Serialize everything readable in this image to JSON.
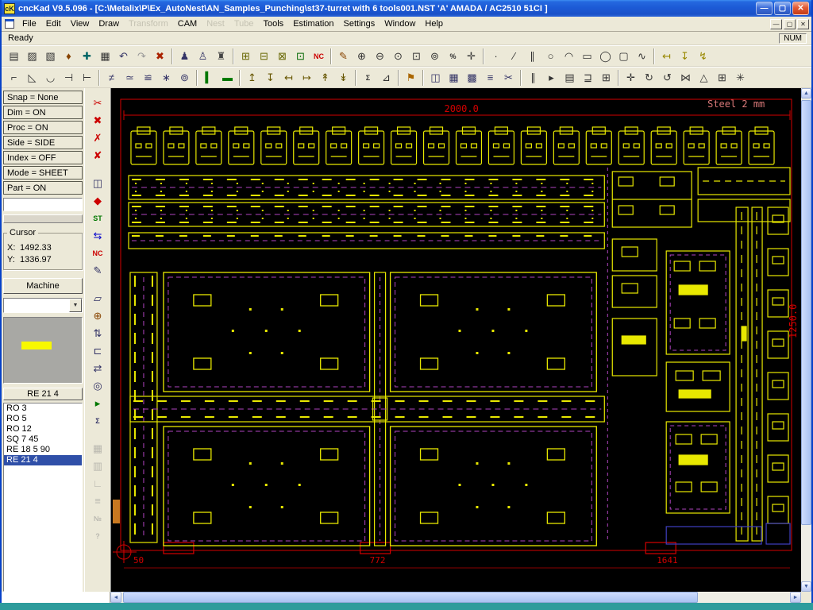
{
  "window": {
    "title": "cncKad V9.5.096 - [C:\\Metalix\\P\\Ex_AutoNest\\AN_Samples_Punching\\st37-turret with 6 tools001.NST  'A'  AMADA / AC2510   51CI ]",
    "app_icon_text": "cK",
    "controls": {
      "minimize": "—",
      "maximize": "▢",
      "close": "✕"
    },
    "mdi": {
      "minimize": "—",
      "restore": "▢",
      "close": "✕"
    }
  },
  "menu": {
    "items": [
      {
        "label": "File"
      },
      {
        "label": "Edit"
      },
      {
        "label": "View"
      },
      {
        "label": "Draw"
      },
      {
        "label": "Transform",
        "d": 1
      },
      {
        "label": "CAM"
      },
      {
        "label": "Nest",
        "d": 1
      },
      {
        "label": "Tube",
        "d": 1
      },
      {
        "label": "Tools"
      },
      {
        "label": "Estimation"
      },
      {
        "label": "Settings"
      },
      {
        "label": "Window"
      },
      {
        "label": "Help"
      }
    ]
  },
  "statusbar": {
    "ready": "Ready",
    "num": "NUM"
  },
  "toolbar1": {
    "items": [
      {
        "n": "print-icon",
        "g": "▤"
      },
      {
        "n": "open-file-icon",
        "g": "▨"
      },
      {
        "n": "new-part-icon",
        "g": "▧"
      },
      {
        "n": "stamp-icon",
        "g": "♦",
        "c": "#884400"
      },
      {
        "n": "tag-icon",
        "g": "✚",
        "c": "#006666"
      },
      {
        "n": "save-icon",
        "g": "▦"
      },
      {
        "n": "undo-icon",
        "g": "↶",
        "c": "#333366"
      },
      {
        "n": "redo-icon",
        "g": "↷",
        "c": "#999999"
      },
      {
        "n": "delete-icon",
        "g": "✖",
        "c": "#aa2200"
      },
      {
        "sep": true
      },
      {
        "n": "punch-tool-icon",
        "g": "♟",
        "c": "#333366"
      },
      {
        "n": "sequence-icon",
        "g": "♙",
        "c": "#333366"
      },
      {
        "n": "turret-setup-icon",
        "g": "♜",
        "c": "#444444"
      },
      {
        "sep": true
      },
      {
        "n": "auto-punch-icon",
        "g": "⊞",
        "c": "#666600"
      },
      {
        "n": "common-punch-icon",
        "g": "⊟",
        "c": "#666600"
      },
      {
        "n": "micro-joint-icon",
        "g": "⊠",
        "c": "#666600"
      },
      {
        "n": "sheet-icon",
        "g": "⊡",
        "c": "#006600"
      },
      {
        "n": "nc-generate-icon",
        "g": "NC",
        "c": "#cc0000",
        "t": 1
      },
      {
        "sep": true
      },
      {
        "n": "draw-pencil-icon",
        "g": "✎",
        "c": "#884400"
      },
      {
        "n": "zoom-in-icon",
        "g": "⊕"
      },
      {
        "n": "zoom-out-icon",
        "g": "⊖"
      },
      {
        "n": "zoom-all-icon",
        "g": "⊙"
      },
      {
        "n": "zoom-window-icon",
        "g": "⊡"
      },
      {
        "n": "zoom-part-icon",
        "g": "⊚"
      },
      {
        "n": "zoom-scale-icon",
        "g": "%",
        "t": 1
      },
      {
        "n": "pan-icon",
        "g": "✛"
      },
      {
        "sep": true
      },
      {
        "n": "draw-point-icon",
        "g": "∙"
      },
      {
        "n": "draw-line-icon",
        "g": "∕"
      },
      {
        "n": "draw-parallel-icon",
        "g": "∥"
      },
      {
        "n": "draw-circle-icon",
        "g": "○"
      },
      {
        "n": "draw-arc-icon",
        "g": "◠"
      },
      {
        "n": "draw-rect-icon",
        "g": "▭"
      },
      {
        "n": "draw-ellipse-icon",
        "g": "◯"
      },
      {
        "n": "draw-rounded-rect-icon",
        "g": "▢"
      },
      {
        "n": "draw-polyline-icon",
        "g": "∿"
      },
      {
        "sep": true
      },
      {
        "n": "dim-horizontal-icon",
        "g": "↤",
        "c": "#998800"
      },
      {
        "n": "dim-vertical-icon",
        "g": "↧",
        "c": "#998800"
      },
      {
        "n": "dim-diagonal-icon",
        "g": "↯",
        "c": "#998800"
      }
    ]
  },
  "toolbar2": {
    "items": [
      {
        "n": "corner-icon",
        "g": "⌐"
      },
      {
        "n": "chamfer-icon",
        "g": "◺"
      },
      {
        "n": "fillet-icon",
        "g": "◡"
      },
      {
        "n": "trim-icon",
        "g": "⊣"
      },
      {
        "n": "extend-icon",
        "g": "⊢"
      },
      {
        "sep": true
      },
      {
        "n": "punch-line-icon",
        "g": "≠",
        "c": "#333366"
      },
      {
        "n": "punch-arc-icon",
        "g": "≃",
        "c": "#333366"
      },
      {
        "n": "punch-area-icon",
        "g": "≌",
        "c": "#333366"
      },
      {
        "n": "destruct-icon",
        "g": "∗",
        "c": "#333366"
      },
      {
        "n": "wheel-tool-icon",
        "g": "⊚",
        "c": "#333366"
      },
      {
        "sep": true
      },
      {
        "n": "green-line-icon",
        "g": "▍",
        "c": "#007700"
      },
      {
        "n": "green-dash-icon",
        "g": "▬",
        "c": "#007700"
      },
      {
        "sep": true
      },
      {
        "n": "tool-up-icon",
        "g": "↥",
        "c": "#665500"
      },
      {
        "n": "tool-down-icon",
        "g": "↧",
        "c": "#665500"
      },
      {
        "n": "tool-left-icon",
        "g": "↤",
        "c": "#665500"
      },
      {
        "n": "tool-right-icon",
        "g": "↦",
        "c": "#665500"
      },
      {
        "n": "offset-icon",
        "g": "↟",
        "c": "#665500"
      },
      {
        "n": "inch-icon",
        "g": "↡",
        "c": "#665500"
      },
      {
        "sep": true
      },
      {
        "n": "sum-icon",
        "g": "Σ",
        "t": 1
      },
      {
        "n": "stats-icon",
        "g": "⊿"
      },
      {
        "sep": true
      },
      {
        "n": "flag-icon",
        "g": "⚑",
        "c": "#aa6600"
      },
      {
        "sep": true
      },
      {
        "n": "windows-icon",
        "g": "◫",
        "c": "#333366"
      },
      {
        "n": "tile-icon",
        "g": "▦",
        "c": "#333366"
      },
      {
        "n": "cascade-icon",
        "g": "▩",
        "c": "#333366"
      },
      {
        "n": "report-icon",
        "g": "≡",
        "c": "#333366"
      },
      {
        "n": "shear-icon",
        "g": "✂",
        "c": "#333366"
      },
      {
        "sep": true
      },
      {
        "n": "pause-icon",
        "g": "∥"
      },
      {
        "n": "run-icon",
        "g": "▸"
      },
      {
        "n": "layers-icon",
        "g": "▤"
      },
      {
        "n": "balance-icon",
        "g": "⊒"
      },
      {
        "n": "frame-icon",
        "g": "⊞"
      },
      {
        "sep": true
      },
      {
        "n": "move-icon",
        "g": "✛"
      },
      {
        "n": "rotate-cw-icon",
        "g": "↻"
      },
      {
        "n": "rotate-ccw-icon",
        "g": "↺"
      },
      {
        "n": "mirror-icon",
        "g": "⋈"
      },
      {
        "n": "scale-icon",
        "g": "△"
      },
      {
        "n": "array-icon",
        "g": "⊞"
      },
      {
        "n": "explode-icon",
        "g": "✳"
      }
    ]
  },
  "side_toolbar": {
    "items": [
      {
        "n": "delete-processing-icon",
        "g": "✂",
        "c": "#cc0000"
      },
      {
        "n": "delete-tooling-icon",
        "g": "✖",
        "c": "#cc0000"
      },
      {
        "n": "delete-sequence-icon",
        "g": "✗",
        "c": "#cc0000"
      },
      {
        "n": "delete-microjoint-icon",
        "g": "✘",
        "c": "#cc0000"
      },
      {
        "gap": true
      },
      {
        "n": "view-nc-icon",
        "g": "◫",
        "c": "#333366"
      },
      {
        "n": "optimize-route-icon",
        "g": "◆",
        "c": "#cc0000"
      },
      {
        "n": "sort-tools-icon",
        "g": "ST",
        "t": 1,
        "c": "#007700"
      },
      {
        "n": "reverse-direction-icon",
        "g": "⇆",
        "c": "#0000cc"
      },
      {
        "n": "nc-code-icon",
        "g": "NC",
        "t": 1,
        "c": "#cc0000"
      },
      {
        "n": "edit-sheet-icon",
        "g": "✎",
        "c": "#333366"
      },
      {
        "gap": true
      },
      {
        "n": "part-properties-icon",
        "g": "▱",
        "c": "#333366"
      },
      {
        "n": "punch-here-icon",
        "g": "⊕",
        "c": "#884400"
      },
      {
        "n": "step-sequence-icon",
        "g": "⇅",
        "c": "#333366"
      },
      {
        "n": "clamps-icon",
        "g": "⊏",
        "c": "#333366"
      },
      {
        "n": "repositioning-icon",
        "g": "⇄",
        "c": "#333366"
      },
      {
        "n": "turret-view-icon",
        "g": "◎",
        "c": "#333366"
      },
      {
        "n": "simulation-icon",
        "g": "▸",
        "c": "#007700"
      },
      {
        "n": "time-study-icon",
        "g": "Σ",
        "t": 1,
        "c": "#333366"
      },
      {
        "gap": true
      },
      {
        "n": "grid-icon",
        "g": "▦",
        "c": "#888888",
        "d": 1
      },
      {
        "n": "snap-grid-icon",
        "g": "▥",
        "c": "#888888",
        "d": 1
      },
      {
        "n": "ortho-icon",
        "g": "∟",
        "c": "#888888",
        "d": 1
      },
      {
        "n": "layers2-icon",
        "g": "≡",
        "c": "#888888",
        "d": 1
      },
      {
        "n": "units-icon",
        "g": "№",
        "t": 1,
        "c": "#888888",
        "d": 1
      },
      {
        "n": "context-help-icon",
        "g": "?",
        "t": 1,
        "c": "#888888",
        "d": 1
      }
    ]
  },
  "left_panel": {
    "status_items": [
      "Snap = None",
      "Dim = ON",
      "Proc = ON",
      "Side = SIDE",
      "Index = OFF",
      "Mode = SHEET",
      "Part = ON"
    ],
    "filter_value": "",
    "cursor": {
      "title": "Cursor",
      "x_label": "X:",
      "x_value": "1492.33",
      "y_label": "Y:",
      "y_value": "1336.97"
    },
    "machine_button": "Machine",
    "machine_combo_value": "",
    "selected_tool_label": "RE 21 4",
    "tools": [
      {
        "label": "RO 3"
      },
      {
        "label": "RO 5"
      },
      {
        "label": "RO 12"
      },
      {
        "label": "SQ 7 45"
      },
      {
        "label": "RE 18 5 90"
      },
      {
        "label": "RE 21 4",
        "selected": true
      }
    ]
  },
  "canvas": {
    "material_label": "Steel  2 mm",
    "width_dim": "2000.0",
    "height_dim": "1250.0",
    "clamp_dims": [
      "50",
      "772",
      "1641"
    ],
    "colors": {
      "background": "#000000",
      "part_outline": "#E8E800",
      "construction": "#B044C0",
      "dimension": "#D40000",
      "remnant": "#C87820",
      "aux": "#4040C0"
    }
  },
  "icons": {
    "up": "▲",
    "down": "▼",
    "left": "◄",
    "right": "►",
    "combo_arrow": "▼"
  }
}
